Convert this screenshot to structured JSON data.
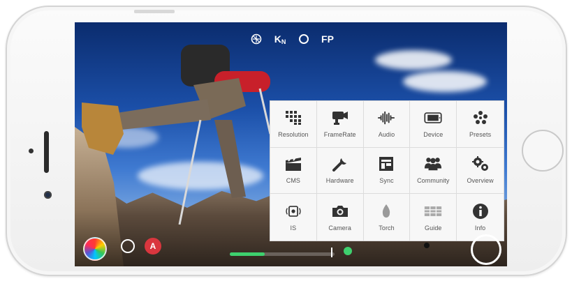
{
  "top_hud": {
    "k_label": "K",
    "k_sub": "N",
    "fp_label": "FP"
  },
  "menu": {
    "items": [
      {
        "label": "Resolution",
        "icon": "resolution-icon"
      },
      {
        "label": "FrameRate",
        "icon": "framerate-icon"
      },
      {
        "label": "Audio",
        "icon": "audio-icon"
      },
      {
        "label": "Device",
        "icon": "device-icon"
      },
      {
        "label": "Presets",
        "icon": "presets-icon"
      },
      {
        "label": "CMS",
        "icon": "cms-icon"
      },
      {
        "label": "Hardware",
        "icon": "hardware-icon"
      },
      {
        "label": "Sync",
        "icon": "sync-icon"
      },
      {
        "label": "Community",
        "icon": "community-icon"
      },
      {
        "label": "Overview",
        "icon": "overview-icon"
      },
      {
        "label": "IS",
        "icon": "is-icon"
      },
      {
        "label": "Camera",
        "icon": "camera-icon"
      },
      {
        "label": "Torch",
        "icon": "torch-icon"
      },
      {
        "label": "Guide",
        "icon": "guide-icon"
      },
      {
        "label": "Info",
        "icon": "info-icon"
      }
    ]
  },
  "bottom_hud": {
    "auto_label": "A",
    "audio_level": 0.33
  },
  "colors": {
    "icon": "#333333",
    "accent_green": "#3ed06e",
    "auto_red": "#d9363e"
  }
}
